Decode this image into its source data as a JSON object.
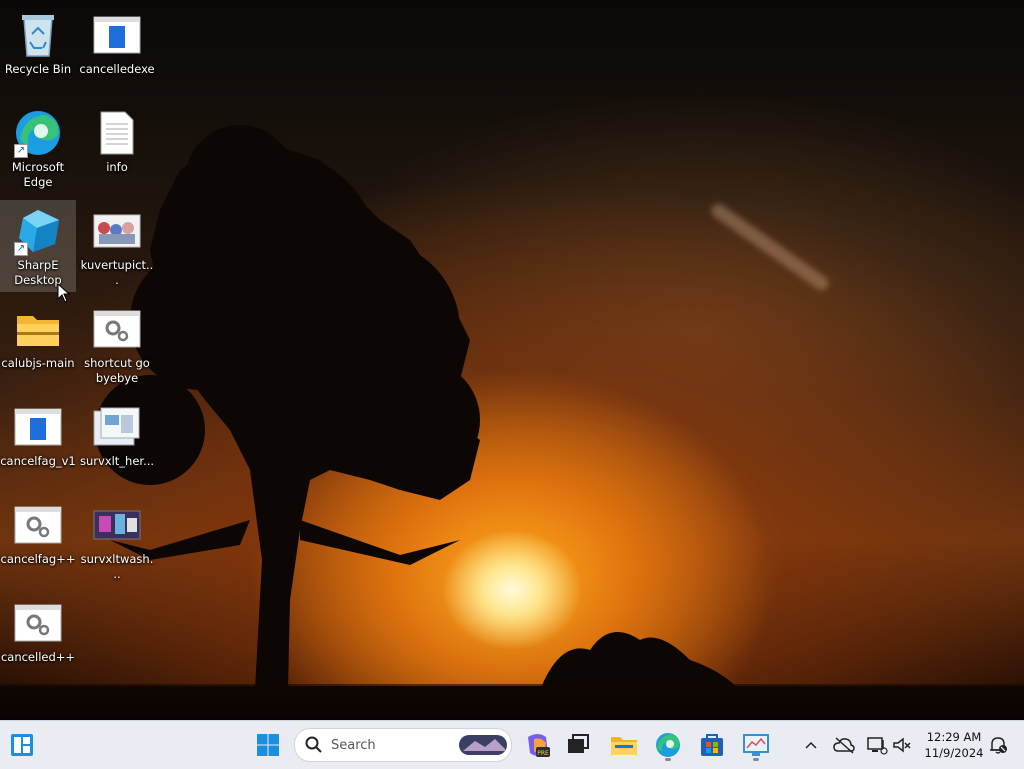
{
  "desktop": {
    "icons": [
      {
        "label": "Recycle Bin",
        "icon": "recycle-bin-icon"
      },
      {
        "label": "cancelledexe",
        "icon": "app-window-icon"
      },
      {
        "label": "Microsoft Edge",
        "icon": "edge-icon"
      },
      {
        "label": "info",
        "icon": "text-document-icon"
      },
      {
        "label": "SharpE Desktop",
        "icon": "blue-cube-icon"
      },
      {
        "label": "kuvertupict...",
        "icon": "image-thumbnail-icon"
      },
      {
        "label": "calubjs-main",
        "icon": "zip-folder-icon"
      },
      {
        "label": "shortcut go byebye",
        "icon": "settings-file-icon"
      },
      {
        "label": "cancelfag_v1",
        "icon": "app-window-icon"
      },
      {
        "label": "survxlt_her...",
        "icon": "installer-icon"
      },
      {
        "label": "cancelfag++",
        "icon": "settings-file-icon"
      },
      {
        "label": "survxltwash...",
        "icon": "image-thumbnail-icon"
      },
      {
        "label": "cancelled++",
        "icon": "settings-file-icon"
      }
    ]
  },
  "taskbar": {
    "widgets_icon": "widgets-icon",
    "start_icon": "windows-start-icon",
    "search_placeholder": "Search",
    "apps": [
      {
        "name": "Copilot",
        "icon": "copilot-icon"
      },
      {
        "name": "Task View",
        "icon": "task-view-icon"
      },
      {
        "name": "File Explorer",
        "icon": "folder-icon"
      },
      {
        "name": "Microsoft Edge",
        "icon": "edge-icon"
      },
      {
        "name": "Microsoft Store",
        "icon": "store-icon"
      },
      {
        "name": "Monitor App",
        "icon": "monitor-icon"
      }
    ],
    "tray": {
      "time": "12:29 AM",
      "date": "11/9/2024"
    }
  },
  "colors": {
    "taskbar_bg": "#e9edf3",
    "accent": "#0078d4"
  }
}
